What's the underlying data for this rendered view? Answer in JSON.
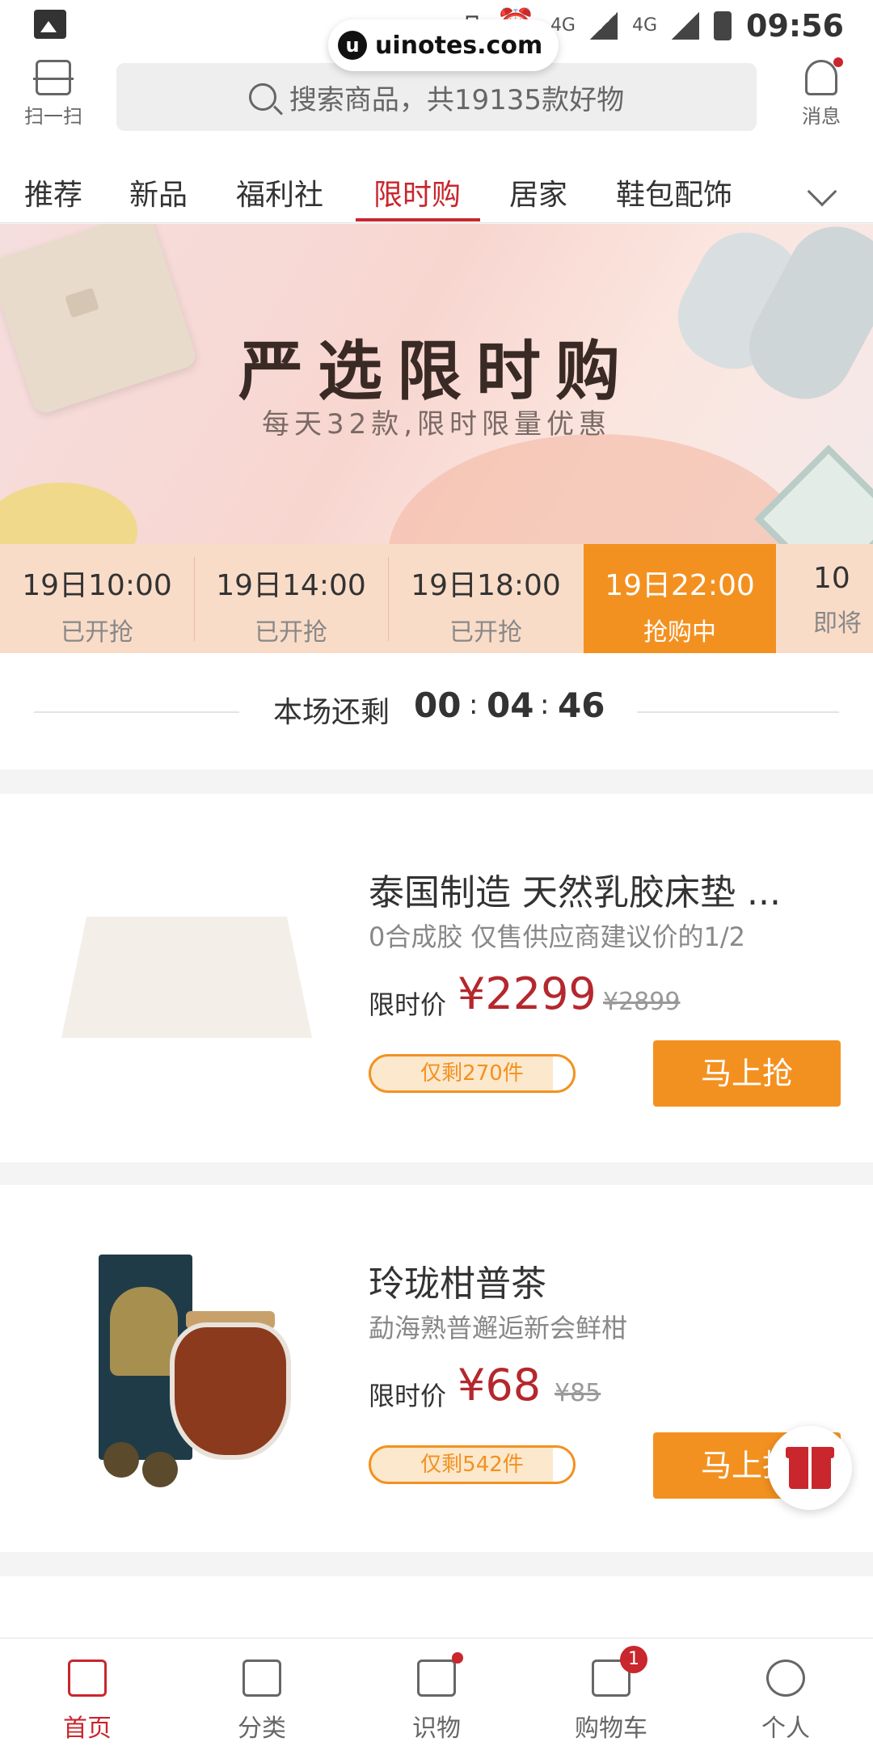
{
  "status_bar": {
    "time": "09:56",
    "net1": "4G",
    "net2": "4G"
  },
  "watermark": {
    "logo": "u",
    "text": "uinotes.com"
  },
  "header": {
    "scan_label": "扫一扫",
    "search_placeholder": "搜索商品，共19135款好物",
    "message_label": "消息"
  },
  "tabs": [
    "推荐",
    "新品",
    "福利社",
    "限时购",
    "居家",
    "鞋包配饰"
  ],
  "active_tab": "限时购",
  "banner": {
    "title": "严选限时购",
    "subtitle": "每天32款,限时限量优惠"
  },
  "sessions": [
    {
      "time": "19日10:00",
      "status": "已开抢"
    },
    {
      "time": "19日14:00",
      "status": "已开抢"
    },
    {
      "time": "19日18:00",
      "status": "已开抢"
    },
    {
      "time": "19日22:00",
      "status": "抢购中"
    },
    {
      "time": "10",
      "status": "即将"
    }
  ],
  "countdown": {
    "label": "本场还剩",
    "hours": "00",
    "minutes": "04",
    "seconds": "46",
    "colon": ":"
  },
  "products": [
    {
      "name": "泰国制造 天然乳胶床垫 ...",
      "desc": "0合成胶 仅售供应商建议价的1/2",
      "price_label": "限时价",
      "price": "¥2299",
      "original_price": "¥2899",
      "stock": "仅剩270件",
      "buy": "马上抢"
    },
    {
      "name": "玲珑柑普茶",
      "desc": "勐海熟普邂逅新会鲜柑",
      "price_label": "限时价",
      "price": "¥68",
      "original_price": "¥85",
      "stock": "仅剩542件",
      "buy": "马上抢"
    }
  ],
  "bottom_nav": {
    "items": [
      "首页",
      "分类",
      "识物",
      "购物车",
      "个人"
    ],
    "active": "首页",
    "cart_badge": "1"
  },
  "colors": {
    "brand_red": "#b4282d",
    "accent_orange": "#f39120"
  }
}
